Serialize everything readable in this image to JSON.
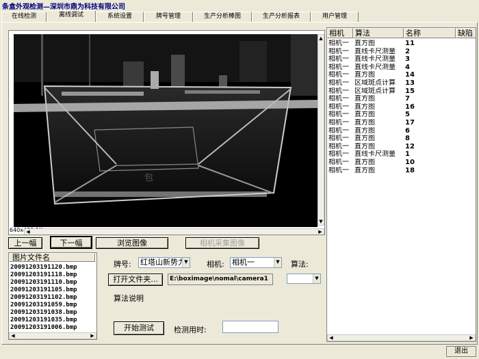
{
  "window": {
    "title": "条盒外观检测—深圳市鼎为科技有限公司"
  },
  "tabs": [
    {
      "label": "在线检测"
    },
    {
      "label": "离线调试"
    },
    {
      "label": "系统设置"
    },
    {
      "label": "牌号管理"
    },
    {
      "label": "生产分析棒图"
    },
    {
      "label": "生产分析报表"
    },
    {
      "label": "用户管理"
    }
  ],
  "active_tab": "离线调试",
  "image_view": {
    "resolution": "640x480 1X",
    "overlay_text": "包"
  },
  "nav": {
    "prev_label": "上一幅",
    "next_label": "下一幅",
    "browse_label": "浏览图像",
    "camera_capture_label": "相机采集图像"
  },
  "file_list": {
    "header": "图片文件名",
    "items": [
      "20091203191120.bmp",
      "20091203191118.bmp",
      "20091203191110.bmp",
      "20091203191105.bmp",
      "20091203191102.bmp",
      "20091203191059.bmp",
      "20091203191038.bmp",
      "20091203191035.bmp",
      "20091203191006.bmp"
    ]
  },
  "controls": {
    "brand_label": "牌号:",
    "brand_value": "红塔山新势力",
    "camera_label": "相机:",
    "camera_value": "相机一",
    "algorithm_label": "算法:",
    "algorithm_value": "",
    "open_folder_label": "打开文件夹...",
    "folder_path": "E:\\boximage\\nomal\\camera1",
    "algorithm_desc_label": "算法说明",
    "start_test_label": "开始测试",
    "detect_time_label": "检测用时:",
    "detect_time_value": ""
  },
  "table": {
    "columns": [
      "相机",
      "算法",
      "名称",
      "缺陷"
    ],
    "rows": [
      [
        "相机一",
        "直方图",
        "11"
      ],
      [
        "相机一",
        "直线卡尺测量",
        "2"
      ],
      [
        "相机一",
        "直线卡尺测量",
        "3"
      ],
      [
        "相机一",
        "直线卡尺测量",
        "4"
      ],
      [
        "相机一",
        "直方图",
        "14"
      ],
      [
        "相机一",
        "区域斑点计算",
        "13"
      ],
      [
        "相机一",
        "区域斑点计算",
        "15"
      ],
      [
        "相机一",
        "直方图",
        "7"
      ],
      [
        "相机一",
        "直方图",
        "16"
      ],
      [
        "相机一",
        "直方图",
        "5"
      ],
      [
        "相机一",
        "直方图",
        "17"
      ],
      [
        "相机一",
        "直方图",
        "6"
      ],
      [
        "相机一",
        "直方图",
        "8"
      ],
      [
        "相机一",
        "直方图",
        "12"
      ],
      [
        "相机一",
        "直线卡尺测量",
        "1"
      ],
      [
        "相机一",
        "直方图",
        "10"
      ],
      [
        "相机一",
        "直方图",
        "18"
      ]
    ]
  },
  "status": {
    "exit_label": "退出"
  },
  "colors": {
    "title_text": "#000080",
    "face": "#ece9d8",
    "image_bg": "#000000"
  }
}
